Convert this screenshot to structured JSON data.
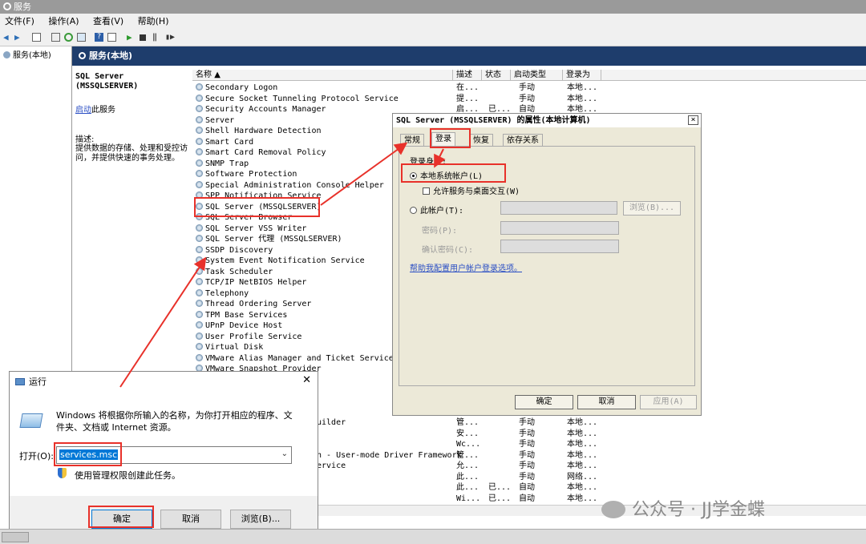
{
  "window": {
    "title": "服务"
  },
  "menu": [
    "文件(F)",
    "操作(A)",
    "查看(V)",
    "帮助(H)"
  ],
  "tree": {
    "item": "服务(本地)"
  },
  "header": {
    "title": "服务(本地)"
  },
  "desc_pane": {
    "service_name": "SQL Server (MSSQLSERVER)",
    "start_link_prefix": "启动",
    "start_link_suffix": "此服务",
    "desc_label": "描述:",
    "desc_text": "提供数据的存储、处理和受控访问，并提供快速的事务处理。"
  },
  "columns": [
    "名称",
    "描述",
    "状态",
    "启动类型",
    "登录为"
  ],
  "services": [
    {
      "name": "Secondary Logon",
      "desc": "在...",
      "status": "",
      "startup": "手动",
      "logon": "本地..."
    },
    {
      "name": "Secure Socket Tunneling Protocol Service",
      "desc": "提...",
      "status": "",
      "startup": "手动",
      "logon": "本地..."
    },
    {
      "name": "Security Accounts Manager",
      "desc": "启...",
      "status": "已...",
      "startup": "自动",
      "logon": "本地..."
    },
    {
      "name": "Server",
      "desc": "",
      "status": "",
      "startup": "",
      "logon": ""
    },
    {
      "name": "Shell Hardware Detection",
      "desc": "",
      "status": "",
      "startup": "",
      "logon": ""
    },
    {
      "name": "Smart Card",
      "desc": "",
      "status": "",
      "startup": "",
      "logon": ""
    },
    {
      "name": "Smart Card Removal Policy",
      "desc": "",
      "status": "",
      "startup": "",
      "logon": ""
    },
    {
      "name": "SNMP Trap",
      "desc": "",
      "status": "",
      "startup": "",
      "logon": ""
    },
    {
      "name": "Software Protection",
      "desc": "",
      "status": "",
      "startup": "",
      "logon": ""
    },
    {
      "name": "Special Administration Console Helper",
      "desc": "",
      "status": "",
      "startup": "",
      "logon": ""
    },
    {
      "name": "SPP Notification Service",
      "desc": "",
      "status": "",
      "startup": "",
      "logon": ""
    },
    {
      "name": "SQL Server (MSSQLSERVER)",
      "desc": "",
      "status": "",
      "startup": "",
      "logon": ""
    },
    {
      "name": "SQL Server Browser",
      "desc": "",
      "status": "",
      "startup": "",
      "logon": ""
    },
    {
      "name": "SQL Server VSS Writer",
      "desc": "",
      "status": "",
      "startup": "",
      "logon": ""
    },
    {
      "name": "SQL Server 代理 (MSSQLSERVER)",
      "desc": "",
      "status": "",
      "startup": "",
      "logon": ""
    },
    {
      "name": "SSDP Discovery",
      "desc": "",
      "status": "",
      "startup": "",
      "logon": ""
    },
    {
      "name": "System Event Notification Service",
      "desc": "",
      "status": "",
      "startup": "",
      "logon": ""
    },
    {
      "name": "Task Scheduler",
      "desc": "",
      "status": "",
      "startup": "",
      "logon": ""
    },
    {
      "name": "TCP/IP NetBIOS Helper",
      "desc": "",
      "status": "",
      "startup": "",
      "logon": ""
    },
    {
      "name": "Telephony",
      "desc": "",
      "status": "",
      "startup": "",
      "logon": ""
    },
    {
      "name": "Thread Ordering Server",
      "desc": "",
      "status": "",
      "startup": "",
      "logon": ""
    },
    {
      "name": "TPM Base Services",
      "desc": "",
      "status": "",
      "startup": "",
      "logon": ""
    },
    {
      "name": "UPnP Device Host",
      "desc": "",
      "status": "",
      "startup": "",
      "logon": ""
    },
    {
      "name": "User Profile Service",
      "desc": "",
      "status": "",
      "startup": "",
      "logon": ""
    },
    {
      "name": "Virtual Disk",
      "desc": "",
      "status": "",
      "startup": "",
      "logon": ""
    },
    {
      "name": "VMware Alias Manager and Ticket Service",
      "desc": "",
      "status": "",
      "startup": "",
      "logon": ""
    },
    {
      "name": "VMware Snapshot Provider",
      "desc": "",
      "status": "",
      "startup": "",
      "logon": ""
    }
  ],
  "lower_rows": [
    {
      "name": "uilder",
      "desc": "管...",
      "status": "",
      "startup": "手动",
      "logon": "本地..."
    },
    {
      "name": "",
      "desc": "安...",
      "status": "",
      "startup": "手动",
      "logon": "本地..."
    },
    {
      "name": "",
      "desc": "Wc...",
      "status": "",
      "startup": "手动",
      "logon": "本地..."
    },
    {
      "name": "n - User-mode Driver Framework",
      "desc": "管...",
      "status": "",
      "startup": "手动",
      "logon": "本地..."
    },
    {
      "name": "ervice",
      "desc": "允...",
      "status": "",
      "startup": "手动",
      "logon": "本地..."
    },
    {
      "name": "",
      "desc": "此...",
      "status": "",
      "startup": "手动",
      "logon": "网络..."
    },
    {
      "name": "",
      "desc": "此...",
      "status": "已...",
      "startup": "自动",
      "logon": "本地..."
    },
    {
      "name": "",
      "desc": "Wi...",
      "status": "已...",
      "startup": "自动",
      "logon": "本地..."
    }
  ],
  "props": {
    "title": "SQL Server (MSSQLSERVER) 的属性(本地计算机)",
    "close": "×",
    "tabs": [
      "常规",
      "登录",
      "恢复",
      "依存关系"
    ],
    "logon_as": "登录身份:",
    "local_system": "本地系统帐户(L)",
    "allow_desktop": "允许服务与桌面交互(W)",
    "this_account": "此帐户(T):",
    "browse": "浏览(B)...",
    "password": "密码(P):",
    "confirm_password": "确认密码(C):",
    "help_link": "帮助我配置用户帐户登录选项。",
    "ok": "确定",
    "cancel": "取消",
    "apply": "应用(A)"
  },
  "run": {
    "title": "运行",
    "close": "✕",
    "desc": "Windows 将根据你所输入的名称，为你打开相应的程序、文件夹、文档或 Internet 资源。",
    "open_label": "打开(O):",
    "input_value": "services.msc",
    "admin_note": "使用管理权限创建此任务。",
    "ok": "确定",
    "cancel": "取消",
    "browse": "浏览(B)..."
  },
  "watermark": "公众号 · JJ学金蝶",
  "colors": {
    "highlight": "#e8312a",
    "header_bg": "#1e3d6c",
    "link": "#2a4ec4"
  }
}
